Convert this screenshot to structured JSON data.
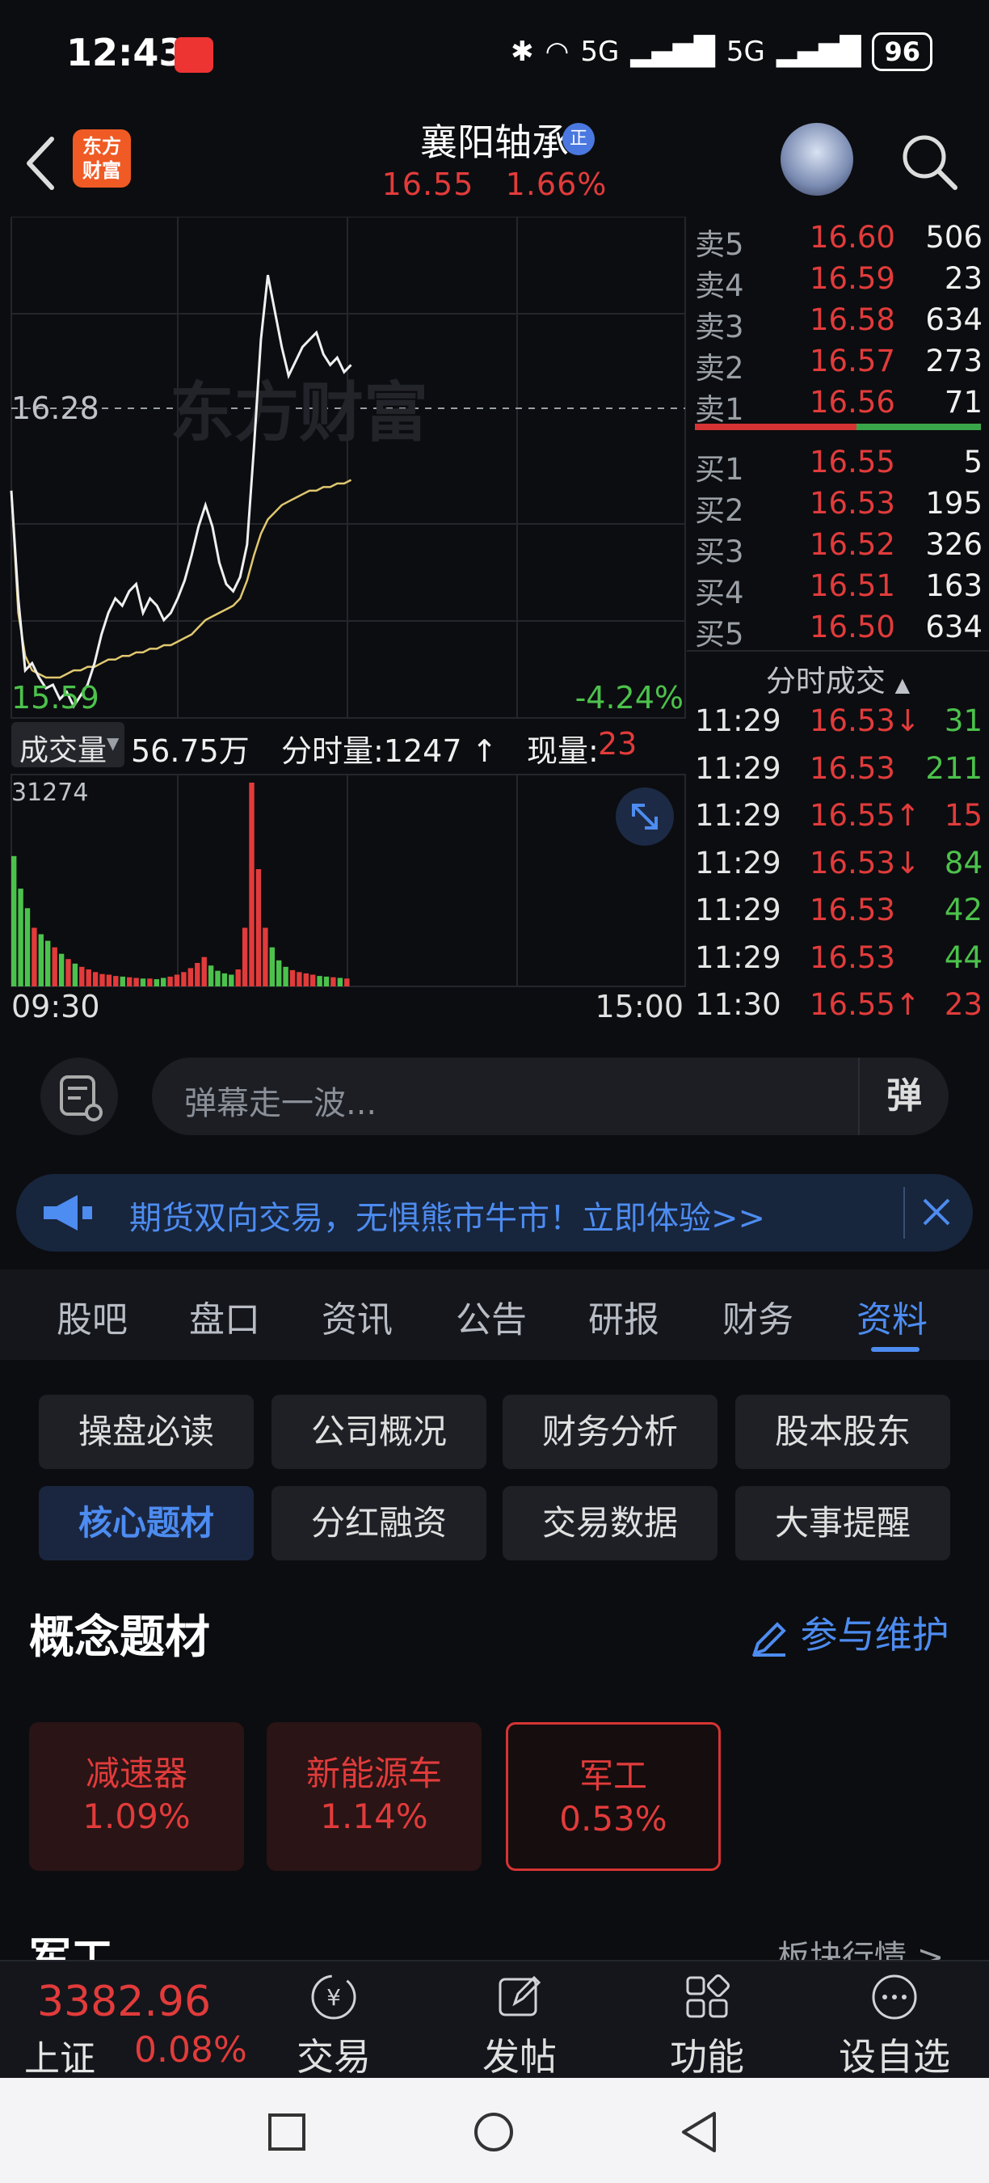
{
  "status_bar": {
    "time": "12:43",
    "network": "5G",
    "network2": "5G",
    "battery": "96"
  },
  "header": {
    "logo_text_1": "东方",
    "logo_text_2": "财富",
    "stock_name": "襄阳轴承",
    "badge": "正",
    "price": "16.55",
    "change_pct": "1.66%"
  },
  "chart": {
    "ref_price": "16.28",
    "low_price": "15.59",
    "low_pct": "-4.24%",
    "watermark": "东方财富",
    "volume_label": "成交量",
    "volume_total": "56.75万",
    "minute_volume": "分时量:1247",
    "current_label": "现量:",
    "current_value": "23",
    "volume_max": "31274",
    "time_start": "09:30",
    "time_end": "15:00",
    "price_series": [
      16.2,
      15.9,
      15.7,
      15.72,
      15.68,
      15.65,
      15.66,
      15.62,
      15.64,
      15.6,
      15.63,
      15.66,
      15.72,
      15.8,
      15.86,
      15.9,
      15.88,
      15.92,
      15.94,
      15.86,
      15.9,
      15.88,
      15.84,
      15.86,
      15.9,
      15.95,
      16.02,
      16.1,
      16.16,
      16.1,
      16.0,
      15.94,
      15.92,
      15.96,
      16.05,
      16.32,
      16.62,
      16.8,
      16.7,
      16.6,
      16.52,
      16.56,
      16.6,
      16.62,
      16.64,
      16.58,
      16.55,
      16.57,
      16.53,
      16.55
    ],
    "avg_series": [
      16.2,
      15.86,
      15.74,
      15.7,
      15.69,
      15.68,
      15.68,
      15.68,
      15.69,
      15.7,
      15.7,
      15.71,
      15.71,
      15.72,
      15.73,
      15.73,
      15.74,
      15.74,
      15.75,
      15.75,
      15.76,
      15.76,
      15.77,
      15.77,
      15.78,
      15.79,
      15.8,
      15.82,
      15.84,
      15.85,
      15.86,
      15.87,
      15.88,
      15.9,
      15.95,
      16.02,
      16.08,
      16.12,
      16.14,
      16.16,
      16.17,
      16.18,
      16.19,
      16.2,
      16.2,
      16.21,
      16.21,
      16.22,
      16.22,
      16.23
    ],
    "volume_series": [
      20000,
      15000,
      12000,
      9000,
      8000,
      7000,
      6000,
      5000,
      4200,
      3500,
      3000,
      2600,
      2200,
      1900,
      1800,
      1600,
      1500,
      1400,
      1300,
      1200,
      1200,
      1100,
      1300,
      1500,
      1800,
      2200,
      2800,
      3600,
      4500,
      3200,
      2400,
      2000,
      1800,
      2600,
      9000,
      31274,
      18000,
      9000,
      6000,
      4000,
      3000,
      2500,
      2200,
      2000,
      1800,
      1600,
      1500,
      1400,
      1300,
      1200
    ]
  },
  "order_book": {
    "asks": [
      {
        "label": "卖5",
        "price": "16.60",
        "vol": "506"
      },
      {
        "label": "卖4",
        "price": "16.59",
        "vol": "23"
      },
      {
        "label": "卖3",
        "price": "16.58",
        "vol": "634"
      },
      {
        "label": "卖2",
        "price": "16.57",
        "vol": "273"
      },
      {
        "label": "卖1",
        "price": "16.56",
        "vol": "71"
      }
    ],
    "bids": [
      {
        "label": "买1",
        "price": "16.55",
        "vol": "5"
      },
      {
        "label": "买2",
        "price": "16.53",
        "vol": "195"
      },
      {
        "label": "买3",
        "price": "16.52",
        "vol": "326"
      },
      {
        "label": "买4",
        "price": "16.51",
        "vol": "163"
      },
      {
        "label": "买5",
        "price": "16.50",
        "vol": "634"
      }
    ],
    "trades_title": "分时成交",
    "trades": [
      {
        "time": "11:29",
        "price": "16.53↓",
        "vol": "31",
        "dir": "down"
      },
      {
        "time": "11:29",
        "price": "16.53",
        "vol": "211",
        "dir": "down"
      },
      {
        "time": "11:29",
        "price": "16.55↑",
        "vol": "15",
        "dir": "up"
      },
      {
        "time": "11:29",
        "price": "16.53↓",
        "vol": "84",
        "dir": "down"
      },
      {
        "time": "11:29",
        "price": "16.53",
        "vol": "42",
        "dir": "down"
      },
      {
        "time": "11:29",
        "price": "16.53",
        "vol": "44",
        "dir": "down"
      },
      {
        "time": "11:30",
        "price": "16.55↑",
        "vol": "23",
        "dir": "up"
      }
    ]
  },
  "danmu": {
    "placeholder": "弹幕走一波...",
    "button": "弹"
  },
  "ad": {
    "text": "期货双向交易，无惧熊市牛市！立即体验>>"
  },
  "tabs": [
    "股吧",
    "盘口",
    "资讯",
    "公告",
    "研报",
    "财务",
    "资料"
  ],
  "sub_buttons": [
    "操盘必读",
    "公司概况",
    "财务分析",
    "股本股东",
    "核心题材",
    "分红融资",
    "交易数据",
    "大事提醒"
  ],
  "concept": {
    "title": "概念题材",
    "maintain": "参与维护",
    "cards": [
      {
        "name": "减速器",
        "change": "1.09%"
      },
      {
        "name": "新能源车",
        "change": "1.14%"
      },
      {
        "name": "军工",
        "change": "0.53%"
      }
    ],
    "next_section": "军工",
    "board_link": "板块行情 >"
  },
  "bottom_nav": {
    "index_value": "3382.96",
    "index_name": "上证",
    "index_change": "0.08%",
    "items": [
      "交易",
      "发帖",
      "功能",
      "设自选"
    ]
  },
  "colors": {
    "up": "#e23b3b",
    "down": "#4cc24c",
    "accent": "#4d8cf0",
    "avg_line": "#e0c870"
  }
}
